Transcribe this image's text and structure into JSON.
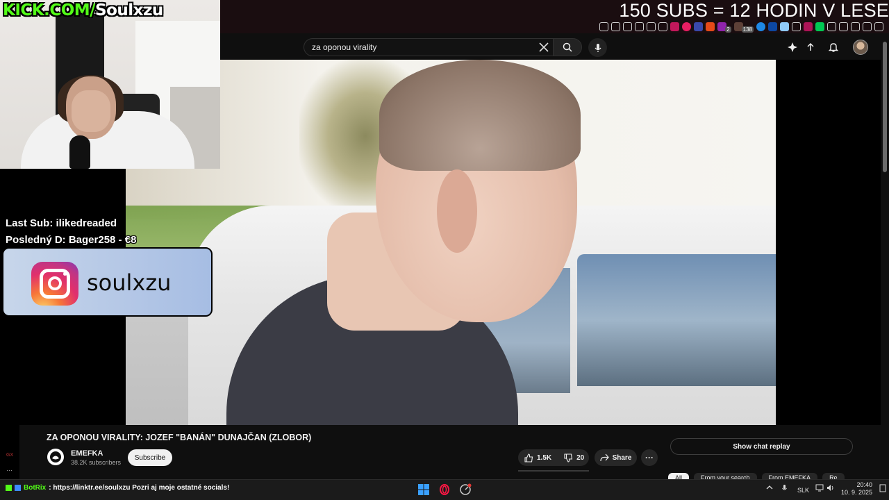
{
  "overlay": {
    "kick_domain": "KICK.COM/",
    "kick_user": "Soulxzu",
    "goal_text": "150 SUBS = 12 HODIN V LESE",
    "last_sub": "Last Sub: ilikedreaded",
    "last_donation": "Posledný D: Bager258 - €8",
    "instagram_handle": "soulxzu"
  },
  "search": {
    "query": "za oponou virality"
  },
  "video": {
    "title": "ZA OPONOU VIRALITY: JOZEF \"BANÁN\" DUNAJČAN (ZLOBOR)",
    "channel": "EMEFKA",
    "subscribers": "38.2K subscribers",
    "subscribe_label": "Subscribe",
    "likes": "1.5K",
    "dislikes": "20",
    "share_label": "Share"
  },
  "chat": {
    "replay_label": "Show chat replay"
  },
  "chips": [
    "All",
    "From your search",
    "From EMEFKA",
    "Re"
  ],
  "side": {
    "gx": "GX",
    "dots": "···"
  },
  "taskbar": {
    "bot_name": "BotRix",
    "bot_message": ": https://linktr.ee/soulxzu Pozri aj moje ostatné socials!",
    "language": "SLK",
    "time": "20:40",
    "date": "10. 9. 2025"
  },
  "colors": {
    "kick_green": "#53fc18",
    "background": "#0f0f0f",
    "chip_bg": "#272727"
  }
}
